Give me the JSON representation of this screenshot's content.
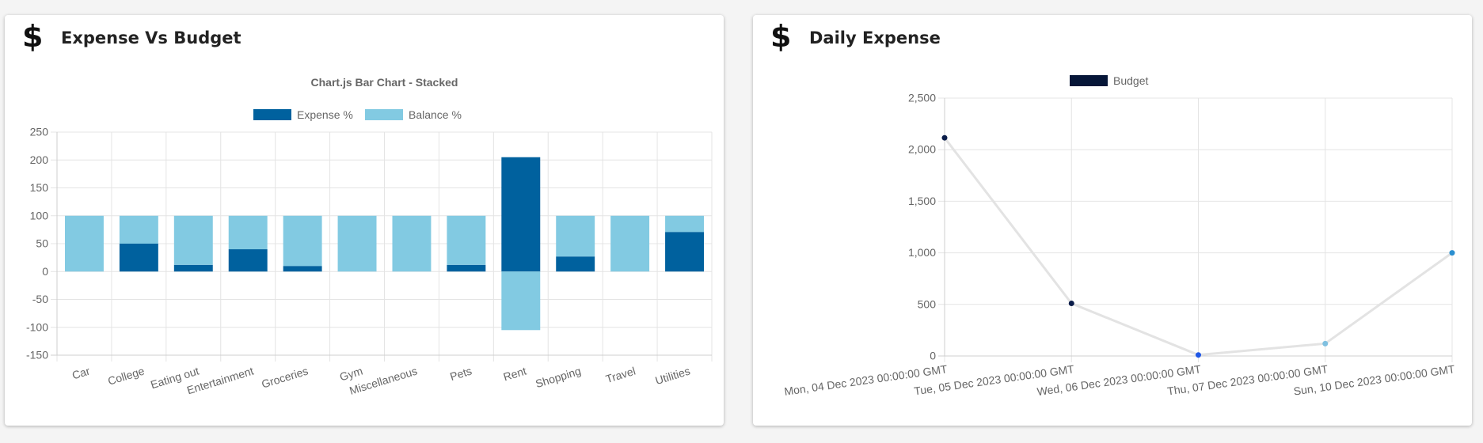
{
  "cards": [
    {
      "title": "Expense Vs Budget",
      "icon": "dollar-icon"
    },
    {
      "title": "Daily Expense",
      "icon": "dollar-icon"
    }
  ],
  "chart_data": [
    {
      "type": "bar",
      "stacked": true,
      "title": "Chart.js Bar Chart - Stacked",
      "legend_position": "top",
      "categories": [
        "Car",
        "College",
        "Eating out",
        "Entertainment",
        "Groceries",
        "Gym",
        "Miscellaneous",
        "Pets",
        "Rent",
        "Shopping",
        "Travel",
        "Utilities"
      ],
      "series": [
        {
          "name": "Expense %",
          "color": "#00619e",
          "values": [
            0,
            50,
            12,
            40,
            10,
            0,
            0,
            12,
            205,
            27,
            0,
            71
          ]
        },
        {
          "name": "Balance %",
          "color": "#82cae2",
          "values": [
            100,
            50,
            88,
            60,
            90,
            100,
            100,
            88,
            -105,
            73,
            100,
            29
          ]
        }
      ],
      "ylim": [
        -150,
        250
      ],
      "yticks": [
        -150,
        -100,
        -50,
        0,
        50,
        100,
        150,
        200,
        250
      ],
      "grid": true
    },
    {
      "type": "line",
      "legend_position": "top",
      "x": [
        "Mon, 04 Dec 2023 00:00:00 GMT",
        "Tue, 05 Dec 2023 00:00:00 GMT",
        "Wed, 06 Dec 2023 00:00:00 GMT",
        "Thu, 07 Dec 2023 00:00:00 GMT",
        "Sun, 10 Dec 2023 00:00:00 GMT"
      ],
      "series": [
        {
          "name": "Budget",
          "legend_color": "#061638",
          "line_color": "#e3e3e3",
          "values": [
            2115,
            510,
            10,
            120,
            1000
          ],
          "point_colors": [
            "#0b1d4a",
            "#0b1d4a",
            "#1f57e6",
            "#7fc0e0",
            "#2b8fd0"
          ]
        }
      ],
      "ylim": [
        0,
        2500
      ],
      "yticks": [
        0,
        500,
        1000,
        1500,
        2000,
        2500
      ],
      "ytick_labels": [
        "0",
        "500",
        "1,000",
        "1,500",
        "2,000",
        "2,500"
      ],
      "grid": true
    }
  ]
}
